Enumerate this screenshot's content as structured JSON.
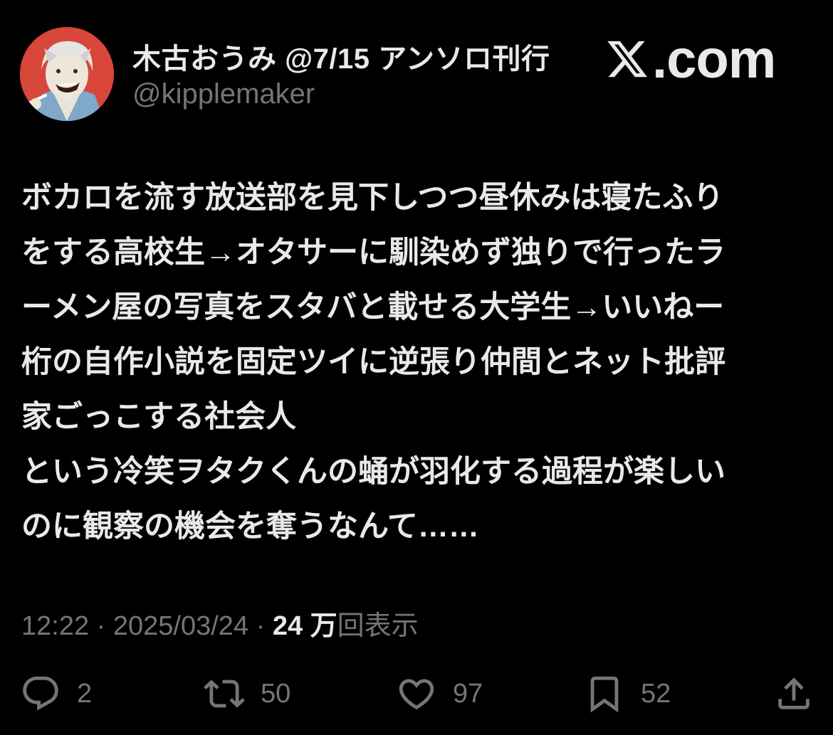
{
  "header": {
    "display_name": "木古おうみ @7/15 アンソロ刊行",
    "handle": "@kipplemaker",
    "brand_text": ".com"
  },
  "tweet": {
    "lines": [
      "ボカロを流す放送部を見下しつつ昼休みは寝たふり",
      "をする高校生→オタサーに馴染めず独りで行ったラ",
      "ーメン屋の写真をスタバと載せる大学生→いいねー",
      "桁の自作小説を固定ツイに逆張り仲間とネット批評",
      "家ごっこする社会人",
      "という冷笑ヲタクくんの蛹が羽化する過程が楽しい",
      "のに観察の機会を奪うなんて……"
    ]
  },
  "meta": {
    "time": "12:22",
    "sep1": " · ",
    "date": "2025/03/24",
    "sep2": " · ",
    "views_count": "24 万",
    "views_label": "回表示"
  },
  "actions": {
    "reply_count": "2",
    "retweet_count": "50",
    "like_count": "97",
    "bookmark_count": "52"
  },
  "icons": {
    "reply": "reply-icon",
    "retweet": "retweet-icon",
    "like": "heart-icon",
    "bookmark": "bookmark-icon",
    "share": "share-icon"
  },
  "colors": {
    "background": "#000000",
    "primary_text": "#e7e9ea",
    "secondary_text": "#71767b",
    "avatar_bg": "#d9463a"
  }
}
